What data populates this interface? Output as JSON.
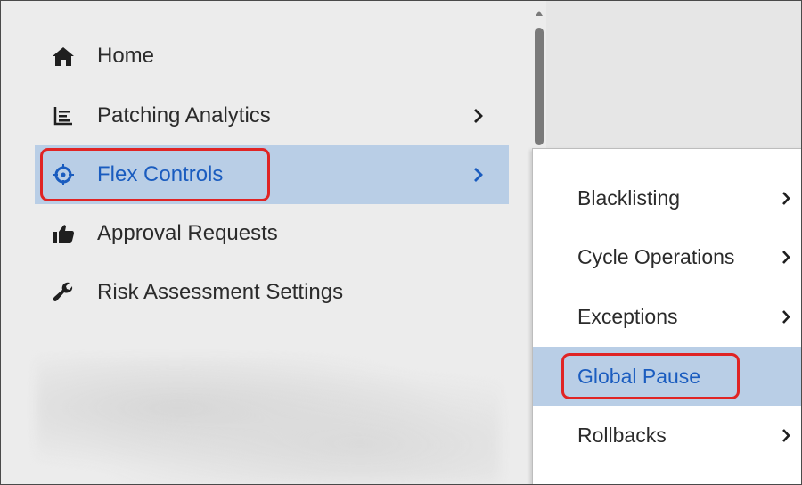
{
  "sidebar": {
    "items": [
      {
        "label": "Home",
        "icon": "home-icon"
      },
      {
        "label": "Patching Analytics",
        "icon": "chart-icon",
        "has_submenu": true
      },
      {
        "label": "Flex Controls",
        "icon": "crosshair-icon",
        "has_submenu": true,
        "active": true
      },
      {
        "label": "Approval Requests",
        "icon": "thumbs-up-icon"
      },
      {
        "label": "Risk Assessment Settings",
        "icon": "wrench-icon"
      }
    ]
  },
  "submenu": {
    "items": [
      {
        "label": "Blacklisting",
        "has_submenu": true
      },
      {
        "label": "Cycle Operations",
        "has_submenu": true
      },
      {
        "label": "Exceptions",
        "has_submenu": true
      },
      {
        "label": "Global Pause",
        "has_submenu": false,
        "active": true
      },
      {
        "label": "Rollbacks",
        "has_submenu": true
      }
    ]
  },
  "colors": {
    "active_background": "#b9cee6",
    "active_text": "#1a5cbf",
    "highlight_border": "#e02424",
    "panel_background": "#ececec"
  }
}
